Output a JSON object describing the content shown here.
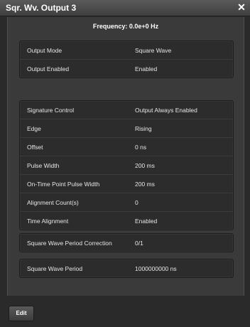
{
  "window": {
    "title": "Sqr. Wv. Output 3",
    "close_icon": "close-icon"
  },
  "frequency": "Frequency: 0.0e+0 Hz",
  "group1": [
    {
      "label": "Output Mode",
      "value": "Square Wave"
    },
    {
      "label": "Output Enabled",
      "value": "Enabled"
    }
  ],
  "group2": [
    {
      "label": "Signature Control",
      "value": "Output Always Enabled"
    },
    {
      "label": "Edge",
      "value": "Rising"
    },
    {
      "label": "Offset",
      "value": "0 ns"
    },
    {
      "label": "Pulse Width",
      "value": "200 ms"
    },
    {
      "label": "On-Time Point Pulse Width",
      "value": "200 ms"
    },
    {
      "label": "Alignment Count(s)",
      "value": "0"
    },
    {
      "label": "Time Alignment",
      "value": "Enabled"
    }
  ],
  "group3": [
    {
      "label": "Square Wave Period Correction",
      "value": "0/1"
    }
  ],
  "group4": [
    {
      "label": "Square Wave Period",
      "value": "1000000000 ns"
    }
  ],
  "footer": {
    "edit_label": "Edit"
  }
}
